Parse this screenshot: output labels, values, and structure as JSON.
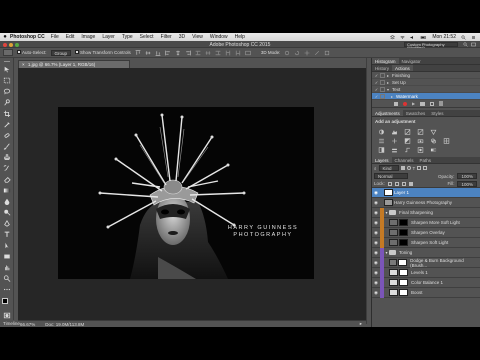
{
  "menubar": {
    "app_name": "Photoshop CC",
    "items": [
      "File",
      "Edit",
      "Image",
      "Layer",
      "Type",
      "Select",
      "Filter",
      "3D",
      "View",
      "Window",
      "Help"
    ],
    "clock": "Mon 21:52"
  },
  "titlebar": {
    "title": "Adobe Photoshop CC 2015",
    "workspace": "Custom Photography (Modified)"
  },
  "options": {
    "auto_select_label": "Auto-Select:",
    "auto_select_value": "Group",
    "transform_label": "Show Transform Controls",
    "mode_label": "3D Mode:"
  },
  "document": {
    "tab_title": "1.jpg @ 66.7% (Layer 1, RGB/16)",
    "watermark_line1": "HARRY GUINNESS",
    "watermark_line2": "PHOTOGRAPHY",
    "zoom": "66.67%",
    "doc_size": "Doc: 19.0M/113.8M"
  },
  "timeline": {
    "label": "Timeline"
  },
  "history_panel": {
    "tabs": [
      "Histogram",
      "Navigator"
    ],
    "tabs2": [
      "History",
      "Actions"
    ],
    "actions": [
      "Finishing",
      "Set Up",
      "Text",
      "Watermark"
    ]
  },
  "adjustments_panel": {
    "tabs": [
      "Adjustments",
      "Swatches",
      "Styles"
    ],
    "heading": "Add an adjustment"
  },
  "layers_panel": {
    "tabs": [
      "Layers",
      "Channels",
      "Paths"
    ],
    "filter_label": "Kind",
    "blend_mode": "Normal",
    "opacity_label": "Opacity:",
    "opacity": "100%",
    "lock_label": "Lock:",
    "fill_label": "Fill:",
    "fill": "100%",
    "layers": [
      {
        "name": "Layer 1",
        "selected": true
      },
      {
        "name": "Harry Guinness Photography"
      },
      {
        "name": "Final Sharpening"
      },
      {
        "name": "Sharpen More Soft Light"
      },
      {
        "name": "Sharpen Overlay"
      },
      {
        "name": "Sharpen Soft Light"
      },
      {
        "name": "Toning"
      },
      {
        "name": "Dodge & Burn Background (Brush..."
      },
      {
        "name": "Levels 1"
      },
      {
        "name": "Color Balance 1"
      },
      {
        "name": "Boost"
      }
    ]
  },
  "colors": {
    "accent": "#4c83c1",
    "orange_label": "#c47a25",
    "purple_label": "#7b55b9",
    "panel": "#535353"
  }
}
